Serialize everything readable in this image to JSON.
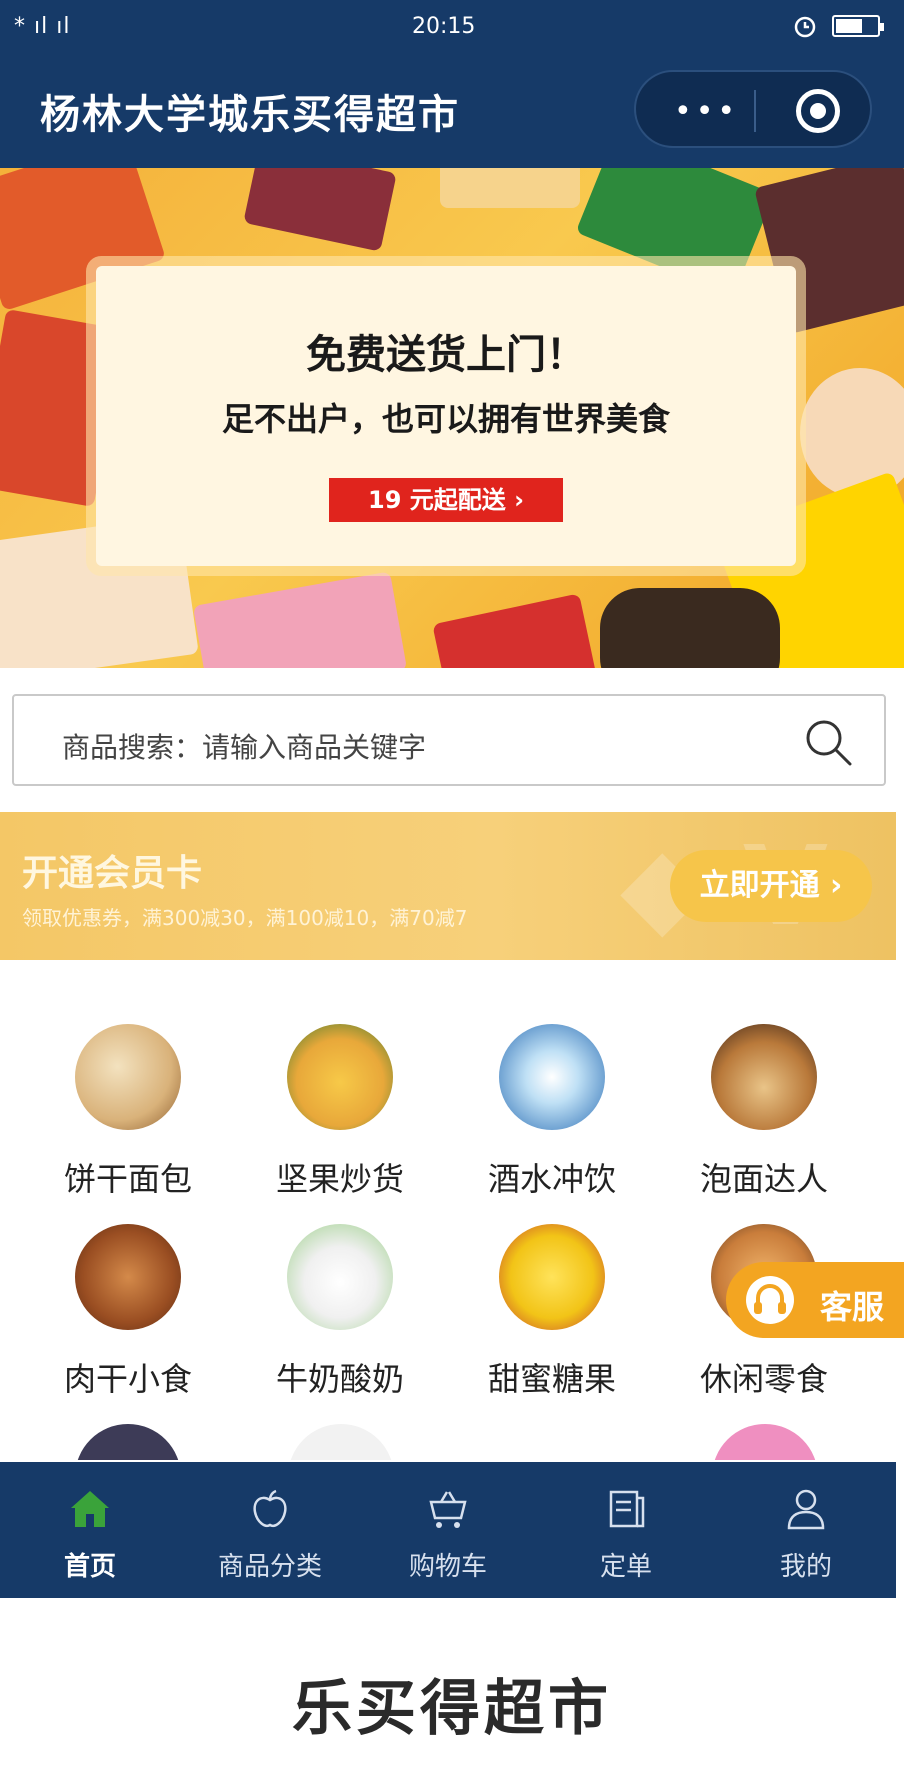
{
  "status_bar": {
    "signal": "* ıl ıl",
    "time": "20:15"
  },
  "header": {
    "title": "杨林大学城乐买得超市"
  },
  "banner": {
    "headline": "免费送货上门！",
    "subline": "足不出户，也可以拥有世界美食",
    "button_label": "19 元起配送 ›"
  },
  "search": {
    "placeholder": "商品搜索：请输入商品关键字"
  },
  "member": {
    "title": "开通会员卡",
    "description": "领取优惠券，满300减30，满100减10，满70减7",
    "button_label": "立即开通 ›"
  },
  "categories": [
    {
      "label": "饼干面包",
      "icon": "biscuit-bread-image"
    },
    {
      "label": "坚果炒货",
      "icon": "nuts-image"
    },
    {
      "label": "酒水冲饮",
      "icon": "drinks-image"
    },
    {
      "label": "泡面达人",
      "icon": "instant-noodles-image"
    },
    {
      "label": "肉干小食",
      "icon": "jerky-image"
    },
    {
      "label": "牛奶酸奶",
      "icon": "milk-image"
    },
    {
      "label": "甜蜜糖果",
      "icon": "candy-image"
    },
    {
      "label": "休闲零食",
      "icon": "snacks-image"
    }
  ],
  "service": {
    "label": "客服"
  },
  "tabbar": [
    {
      "label": "首页",
      "icon": "home-icon",
      "active": true
    },
    {
      "label": "商品分类",
      "icon": "apple-icon",
      "active": false
    },
    {
      "label": "购物车",
      "icon": "cart-icon",
      "active": false
    },
    {
      "label": "定单",
      "icon": "order-icon",
      "active": false
    },
    {
      "label": "我的",
      "icon": "user-icon",
      "active": false
    }
  ],
  "footer": {
    "title": "乐买得超市"
  },
  "colors": {
    "primary": "#163a68",
    "accent": "#f3a521",
    "gold": "#f4c766",
    "red": "#e0241d",
    "home_green": "#3aa33a"
  }
}
